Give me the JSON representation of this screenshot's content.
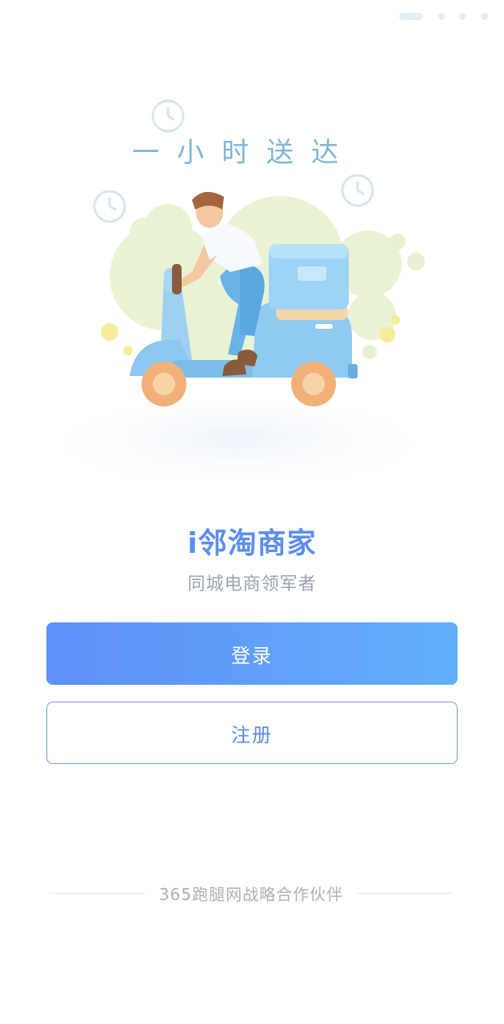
{
  "pager": {
    "total": 4,
    "active_index": 0
  },
  "illustration": {
    "slogan": "一小时送达",
    "subject": "delivery-scooter-rider"
  },
  "brand": {
    "title": "i邻淘商家",
    "subtitle": "同城电商领军者"
  },
  "actions": {
    "login_label": "登录",
    "register_label": "注册"
  },
  "footer": {
    "partner_text": "365跑腿网战略合作伙伴"
  },
  "colors": {
    "accent_blue": "#5b8ef0",
    "gradient_start": "#5f8ff9",
    "gradient_end": "#62aefc",
    "muted_text": "#9aa3ae"
  }
}
